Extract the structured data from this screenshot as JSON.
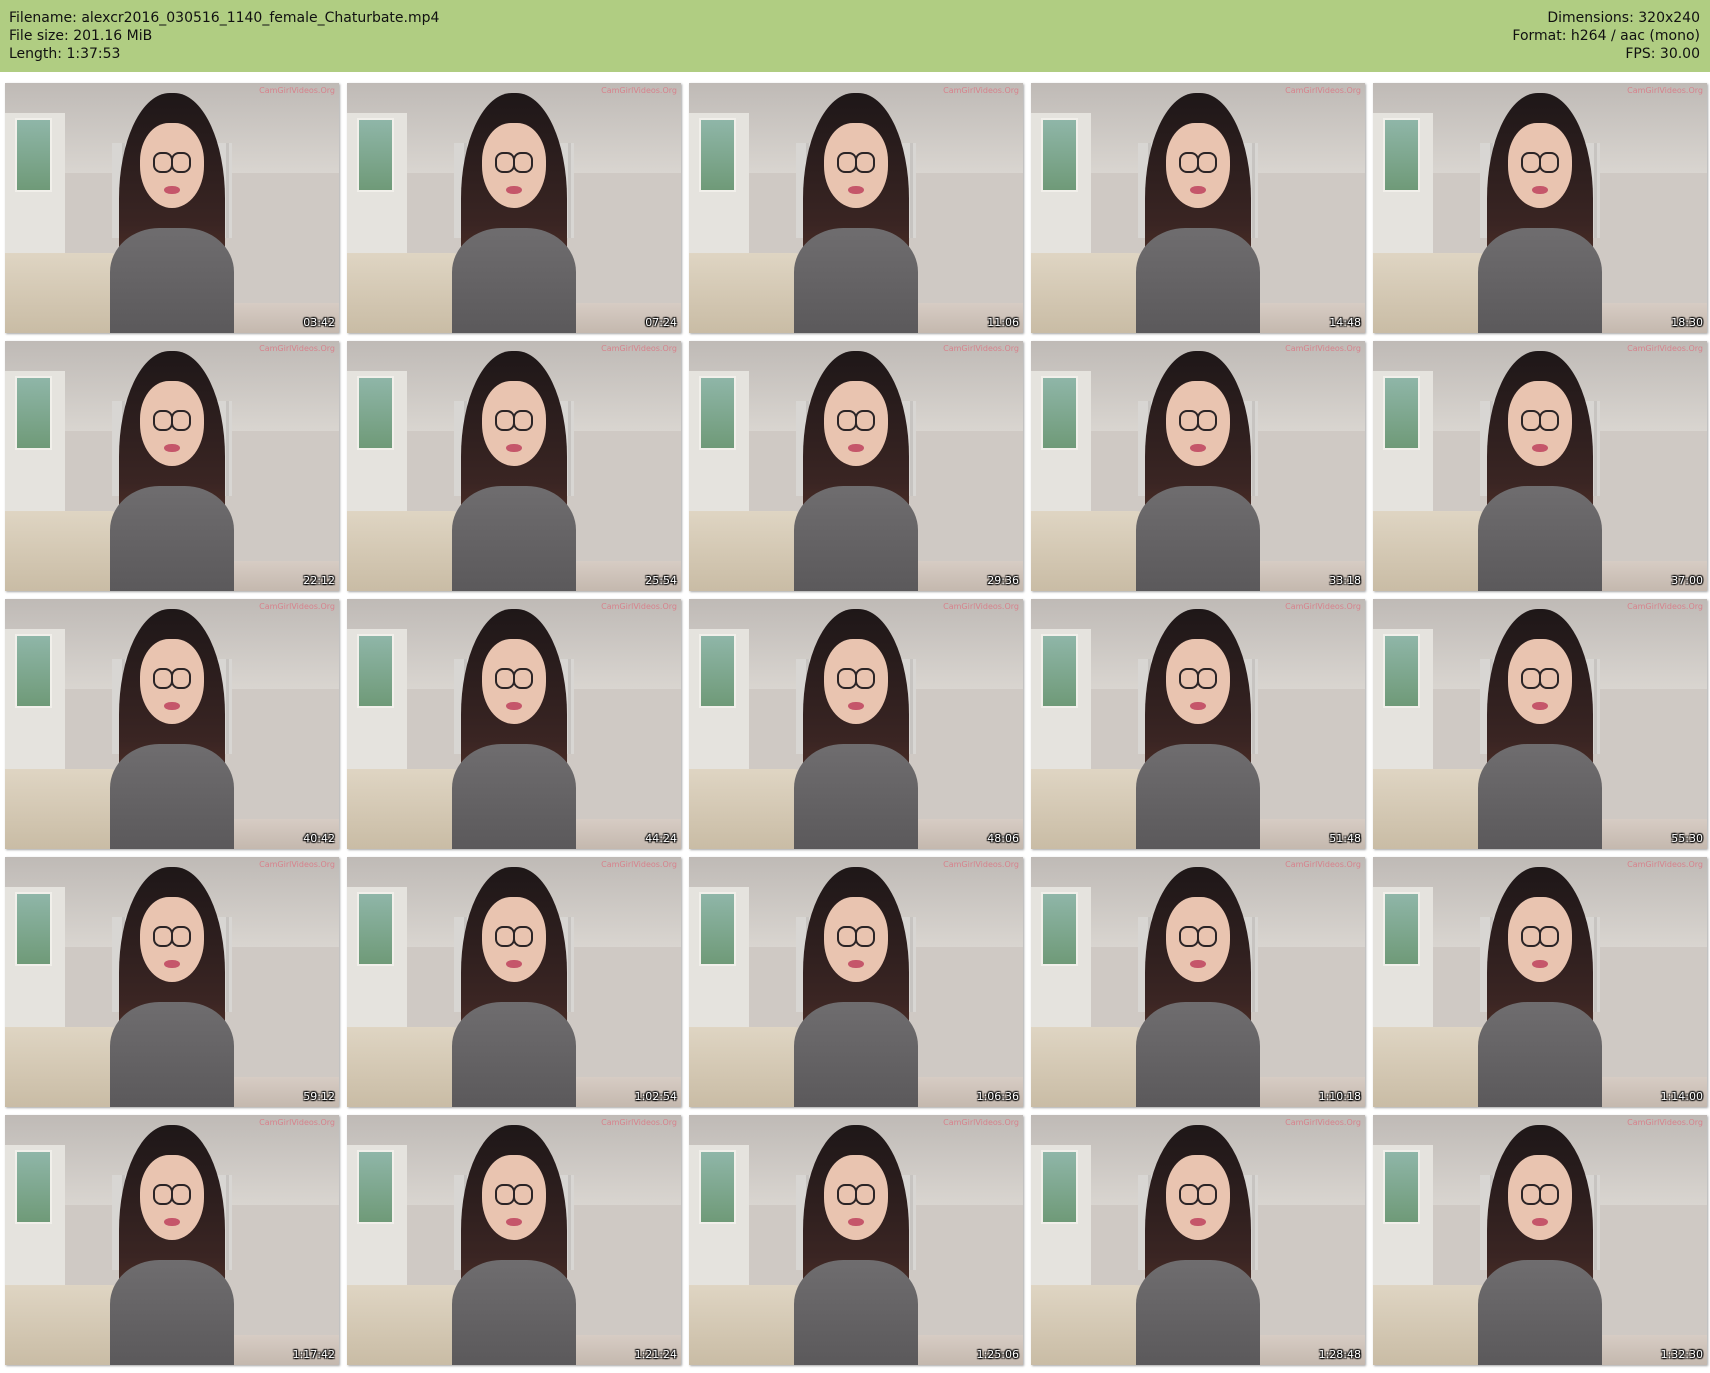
{
  "header": {
    "filename_label": "Filename:",
    "filename": "alexcr2016_030516_1140_female_Chaturbate.mp4",
    "filesize_label": "File size:",
    "filesize": "201.16 MiB",
    "length_label": "Length:",
    "length": "1:37:53",
    "dimensions_label": "Dimensions:",
    "dimensions": "320x240",
    "format_label": "Format:",
    "format": "h264 / aac (mono)",
    "fps_label": "FPS:",
    "fps": "30.00"
  },
  "watermark": "CamGirlVideos.Org",
  "thumbnails": [
    {
      "timestamp": "03:42"
    },
    {
      "timestamp": "07:24"
    },
    {
      "timestamp": "11:06"
    },
    {
      "timestamp": "14:48"
    },
    {
      "timestamp": "18:30"
    },
    {
      "timestamp": "22:12"
    },
    {
      "timestamp": "25:54"
    },
    {
      "timestamp": "29:36"
    },
    {
      "timestamp": "33:18"
    },
    {
      "timestamp": "37:00"
    },
    {
      "timestamp": "40:42"
    },
    {
      "timestamp": "44:24"
    },
    {
      "timestamp": "48:06"
    },
    {
      "timestamp": "51:48"
    },
    {
      "timestamp": "55:30"
    },
    {
      "timestamp": "59:12"
    },
    {
      "timestamp": "1:02:54"
    },
    {
      "timestamp": "1:06:36"
    },
    {
      "timestamp": "1:10:18"
    },
    {
      "timestamp": "1:14:00"
    },
    {
      "timestamp": "1:17:42"
    },
    {
      "timestamp": "1:21:24"
    },
    {
      "timestamp": "1:25:06"
    },
    {
      "timestamp": "1:28:48"
    },
    {
      "timestamp": "1:32:30"
    }
  ],
  "colors": {
    "header_bg": "#b0cd82",
    "page_bg": "#ffffff"
  }
}
